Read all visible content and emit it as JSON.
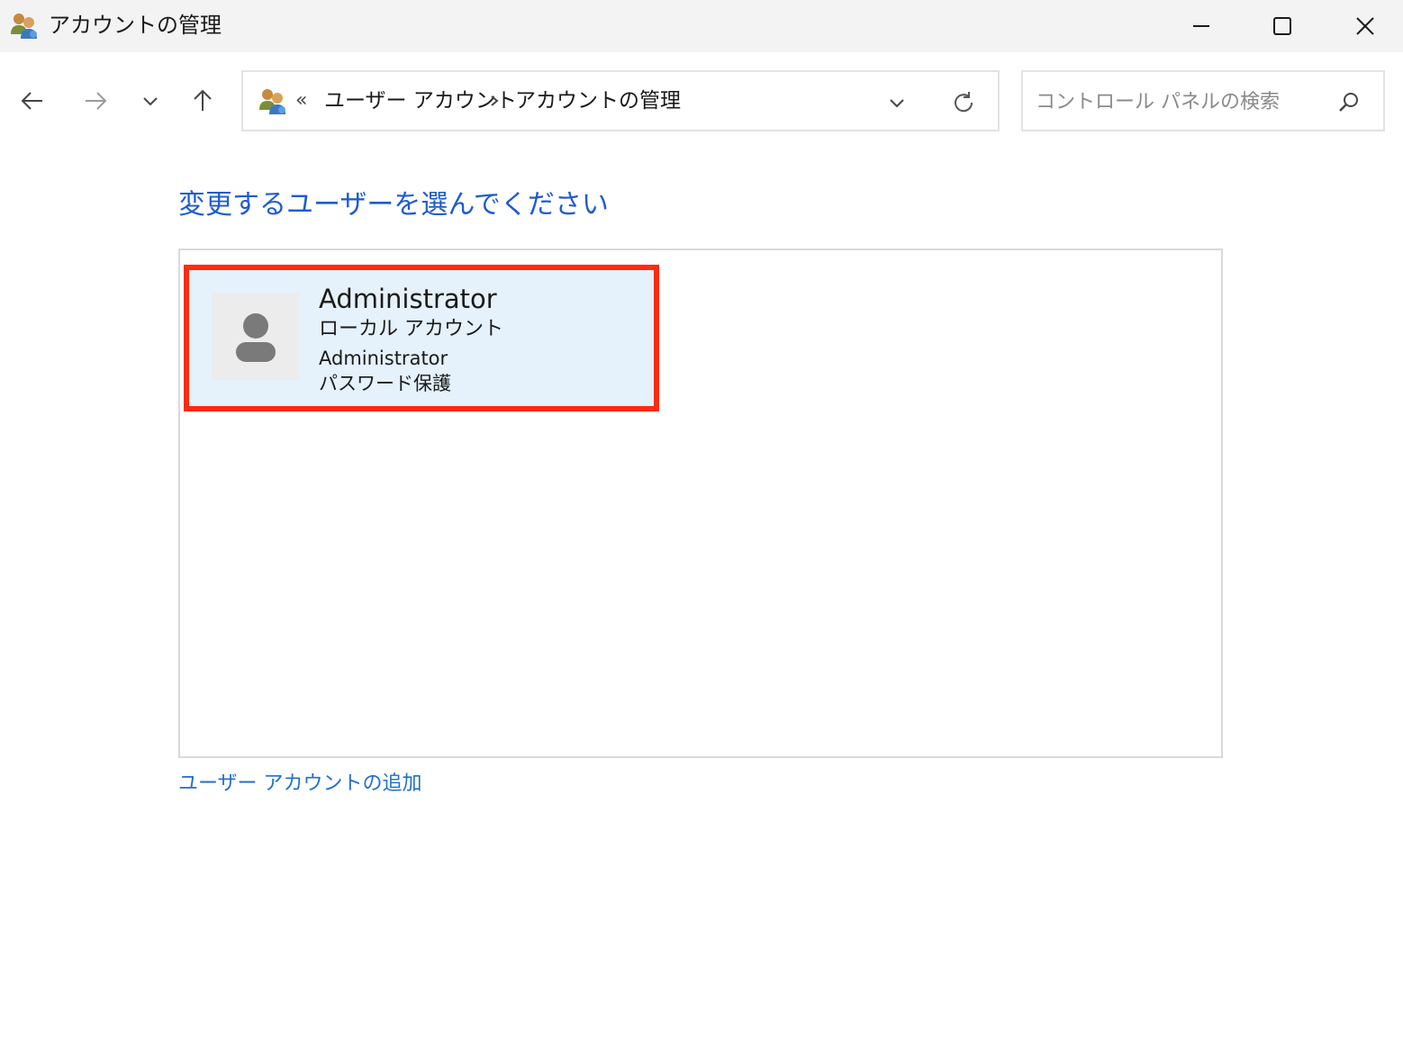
{
  "window": {
    "title": "アカウントの管理",
    "icon": "users-icon",
    "controls": [
      "minimize-icon",
      "maximize-icon",
      "close-icon"
    ]
  },
  "nav": {
    "back_icon": "arrow-left-icon",
    "forward_icon": "arrow-right-icon",
    "recent_icon": "chevron-down-icon",
    "up_icon": "arrow-up-icon"
  },
  "address": {
    "overflow_chevron": "«",
    "crumbs": [
      "ユーザー アカウント",
      "アカウントの管理"
    ],
    "refresh_icon": "refresh-icon"
  },
  "search": {
    "placeholder": "コントロール パネルの検索",
    "icon": "search-icon"
  },
  "main": {
    "heading": "変更するユーザーを選んでください",
    "users": [
      {
        "name": "Administrator",
        "account_type": "ローカル アカウント",
        "group": "Administrator",
        "status": "パスワード保護",
        "avatar": "user-avatar-icon",
        "highlight_color": "#ff2a0f"
      }
    ],
    "add_user_link": "ユーザー アカウントの追加"
  },
  "colors": {
    "link": "#1e6fd0",
    "heading": "#1e5bd0",
    "tile_bg": "#e5f1fb"
  }
}
